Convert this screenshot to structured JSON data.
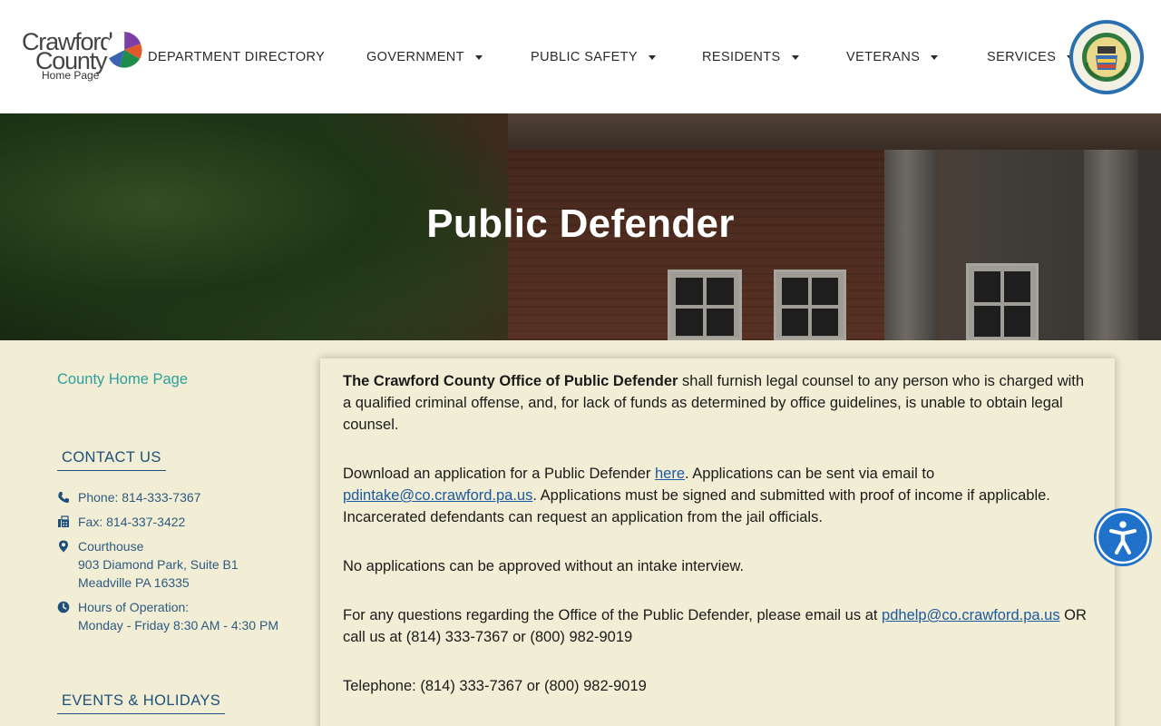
{
  "header": {
    "logo": {
      "line1": "Crawford",
      "line2": "County",
      "line3": "Home Page"
    },
    "nav": [
      {
        "label": "DEPARTMENT DIRECTORY",
        "has_dropdown": false
      },
      {
        "label": "GOVERNMENT",
        "has_dropdown": true
      },
      {
        "label": "PUBLIC SAFETY",
        "has_dropdown": true
      },
      {
        "label": "RESIDENTS",
        "has_dropdown": true
      },
      {
        "label": "VETERANS",
        "has_dropdown": true
      },
      {
        "label": "SERVICES",
        "has_dropdown": true
      }
    ],
    "seal_icon": "county-seal-icon"
  },
  "hero": {
    "title": "Public Defender"
  },
  "sidebar": {
    "home_link": "County Home Page",
    "contact_heading": "CONTACT US",
    "contact": {
      "phone": "Phone: 814-333-7367",
      "fax": "Fax: 814-337-3422",
      "address_line1": "Courthouse",
      "address_line2": "903 Diamond Park, Suite B1",
      "address_line3": "Meadville PA 16335",
      "hours_line1": "Hours of Operation:",
      "hours_line2": "Monday - Friday 8:30 AM - 4:30 PM"
    },
    "events_heading": "EVENTS & HOLIDAYS"
  },
  "content": {
    "p1_bold": "The Crawford County Office of Public Defender",
    "p1_rest": " shall furnish legal counsel to any person who is charged with a qualified criminal offense, and, for lack of funds as determined by office guidelines, is unable to obtain legal counsel.",
    "p2_a": "Download an application for a Public Defender ",
    "p2_link_here": "here",
    "p2_b": ". Applications can be sent via email to ",
    "p2_link_email": "pdintake@co.crawford.pa.us",
    "p2_c": ". Applications must be signed and submitted with proof of income if applicable. Incarcerated defendants can request an application from the jail officials.",
    "p3": "No applications can be approved without an intake interview.",
    "p4_a": "For any questions regarding the Office of the Public Defender, please email us at ",
    "p4_link_email": "pdhelp@co.crawford.pa.us",
    "p4_b": " OR call us at (814) 333-7367 or (800) 982-9019",
    "p5": "Telephone: (814) 333-7367 or (800) 982-9019"
  },
  "colors": {
    "page_bg": "#f1eed5",
    "link_teal": "#2e9e9a",
    "heading_blue": "#1e4f7a",
    "link_blue": "#1c59a0",
    "a11y_blue": "#1f71c9"
  },
  "icons": [
    "phone-icon",
    "fax-icon",
    "map-pin-icon",
    "clock-icon",
    "accessibility-icon",
    "caret-down-icon"
  ]
}
